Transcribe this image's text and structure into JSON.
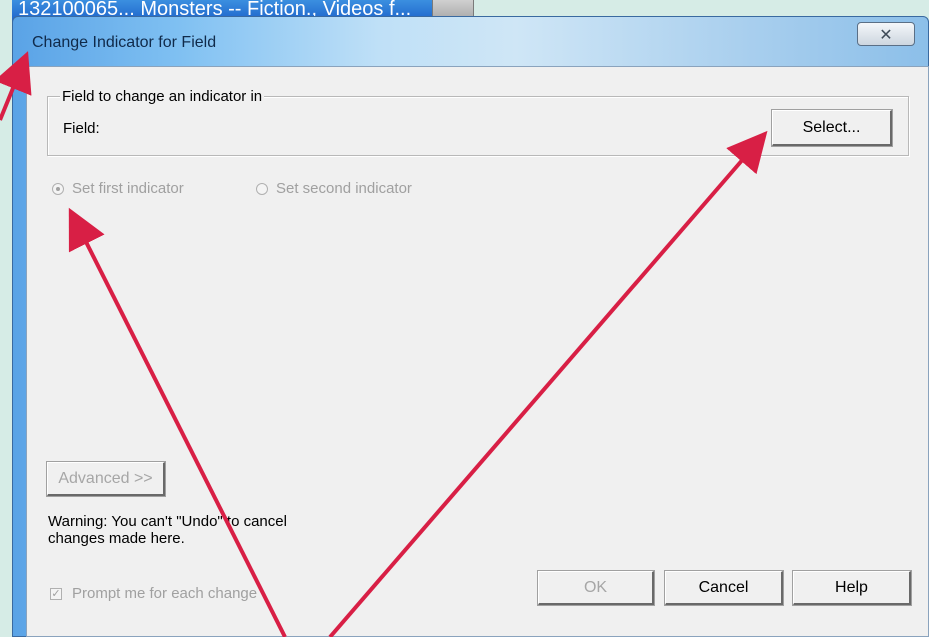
{
  "background_window": {
    "title": "132100065... Monsters -- Fiction., Videos f..."
  },
  "dialog": {
    "title": "Change Indicator for Field",
    "close_glyph": "✕"
  },
  "group": {
    "legend": "Field to change an indicator in",
    "field_label": "Field:",
    "select_label": "Select..."
  },
  "indicator_radios": [
    {
      "label": "Set first indicator",
      "checked": true,
      "enabled": false
    },
    {
      "label": "Set second indicator",
      "checked": false,
      "enabled": false
    }
  ],
  "advanced_label": "Advanced >>",
  "warning": {
    "line1": "Warning: You can't \"Undo\" to cancel",
    "line2": "changes made here."
  },
  "prompt_checkbox": {
    "label": "Prompt me for each change",
    "checked": true,
    "enabled": false,
    "check_glyph": "✓"
  },
  "buttons": {
    "ok": "OK",
    "cancel": "Cancel",
    "help": "Help"
  },
  "colors": {
    "annotation_arrow": "#d81f45",
    "disabled_text": "#a0a0a0",
    "dialog_face": "#f0f0f0"
  },
  "icons": {
    "close": "close-icon",
    "radio": "radio-button-icon",
    "checkbox": "checkbox-icon",
    "arrow": "annotation-arrow-icon"
  }
}
